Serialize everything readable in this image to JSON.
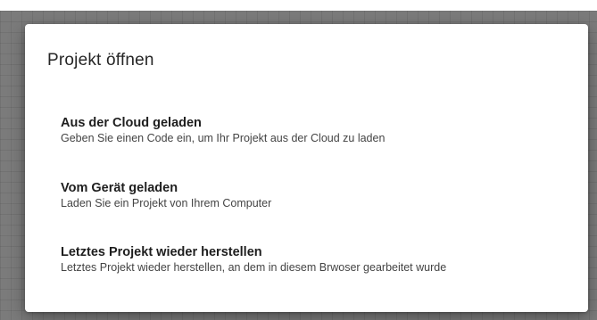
{
  "dialog": {
    "title": "Projekt öffnen",
    "options": [
      {
        "title": "Aus der Cloud geladen",
        "description": "Geben Sie einen Code ein, um Ihr Projekt aus der Cloud zu laden"
      },
      {
        "title": "Vom Gerät geladen",
        "description": "Laden Sie ein Projekt von Ihrem Computer"
      },
      {
        "title": "Letztes Projekt wieder herstellen",
        "description": "Letztes Projekt wieder herstellen, an dem in diesem Brwoser gearbeitet wurde"
      }
    ]
  }
}
